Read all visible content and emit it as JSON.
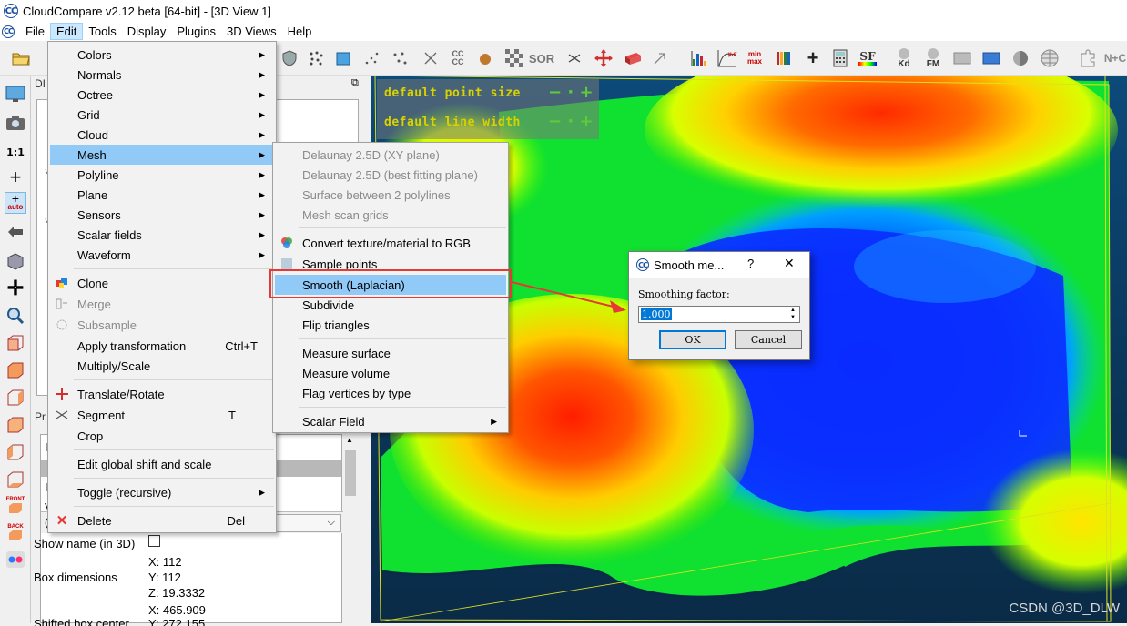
{
  "window": {
    "title": "CloudCompare v2.12 beta [64-bit] - [3D View 1]",
    "logo": "CC"
  },
  "menubar": [
    "File",
    "Edit",
    "Tools",
    "Display",
    "Plugins",
    "3D Views",
    "Help"
  ],
  "toolbar": {
    "cc_label": "CC\nCC",
    "sor_label": "SOR",
    "sf_label": "SF",
    "kd_label": "Kd",
    "fm_label": "FM",
    "nc_label": "N+C",
    "minmax_label": "min\nmax"
  },
  "left_toolbar": {
    "one_to_one": "1:1",
    "auto_label": "auto",
    "front_label": "FRONT",
    "back_label": "BACK"
  },
  "panels": {
    "db_title": "DI",
    "props_title": "Pr"
  },
  "properties": {
    "show_name_label": "Show name (in 3D)",
    "box_dim_label": "Box dimensions",
    "box_x": "X: 112",
    "box_y": "Y: 112",
    "box_z": "Z: 19.3332",
    "shift_x": "X: 465.909",
    "shift_label": "Shifted box center",
    "shift_y": "Y: 272.155"
  },
  "overlay": {
    "line1": "default point size",
    "line2": "default line width",
    "ctl": "− · +"
  },
  "edit_menu": {
    "items": [
      {
        "label": "Colors",
        "submenu": true
      },
      {
        "label": "Normals",
        "submenu": true
      },
      {
        "label": "Octree",
        "submenu": true
      },
      {
        "label": "Grid",
        "submenu": true
      },
      {
        "label": "Cloud",
        "submenu": true
      },
      {
        "label": "Mesh",
        "submenu": true,
        "highlighted": true
      },
      {
        "label": "Polyline",
        "submenu": true
      },
      {
        "label": "Plane",
        "submenu": true
      },
      {
        "label": "Sensors",
        "submenu": true
      },
      {
        "label": "Scalar fields",
        "submenu": true
      },
      {
        "label": "Waveform",
        "submenu": true
      },
      {
        "label": "Clone"
      },
      {
        "label": "Merge",
        "disabled": true
      },
      {
        "label": "Subsample",
        "disabled": true
      },
      {
        "label": "Apply transformation",
        "shortcut": "Ctrl+T"
      },
      {
        "label": "Multiply/Scale"
      },
      {
        "label": "Translate/Rotate"
      },
      {
        "label": "Segment",
        "shortcut": "T"
      },
      {
        "label": "Crop"
      },
      {
        "label": "Edit global shift and scale"
      },
      {
        "label": "Toggle (recursive)",
        "submenu": true
      },
      {
        "label": "Delete",
        "shortcut": "Del"
      }
    ]
  },
  "mesh_menu": {
    "items": [
      {
        "label": "Delaunay 2.5D (XY plane)",
        "disabled": true
      },
      {
        "label": "Delaunay 2.5D (best fitting plane)",
        "disabled": true
      },
      {
        "label": "Surface between 2 polylines",
        "disabled": true
      },
      {
        "label": "Mesh scan grids",
        "disabled": true
      },
      {
        "label": "Convert texture/material to RGB"
      },
      {
        "label": "Sample points"
      },
      {
        "label": "Smooth (Laplacian)",
        "highlighted": true
      },
      {
        "label": "Subdivide"
      },
      {
        "label": "Flip triangles"
      },
      {
        "label": "Measure surface"
      },
      {
        "label": "Measure volume"
      },
      {
        "label": "Flag vertices by type"
      },
      {
        "label": "Scalar Field",
        "submenu": true
      }
    ]
  },
  "dialog": {
    "title": "Smooth me...",
    "help": "?",
    "close": "✕",
    "field_label": "Smoothing factor:",
    "value": "1.000",
    "ok": "OK",
    "cancel": "Cancel"
  },
  "watermark": "CSDN @3D_DLW",
  "colors": {
    "highlight": "#91c9f7",
    "annotation_red": "#e53935",
    "overlay_text": "#d9d200"
  }
}
